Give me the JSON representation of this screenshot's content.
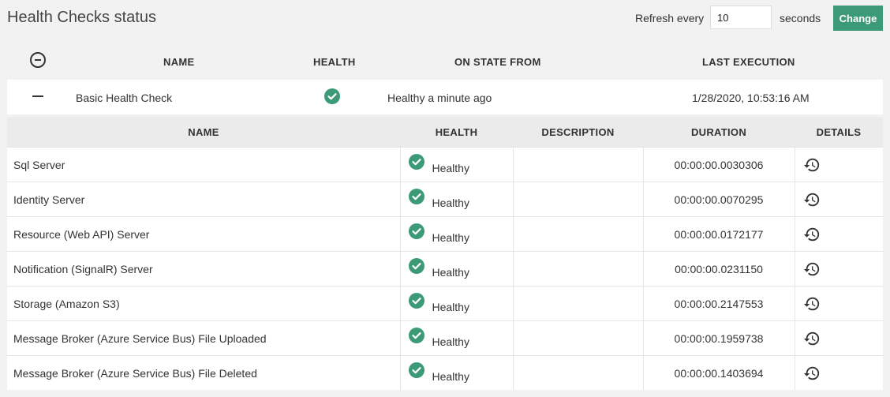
{
  "page": {
    "title": "Health Checks status"
  },
  "refresh": {
    "label": "Refresh every",
    "value": "10",
    "unit": "seconds",
    "button": "Change"
  },
  "main_columns": [
    "NAME",
    "HEALTH",
    "ON STATE FROM",
    "LAST EXECUTION"
  ],
  "check": {
    "name": "Basic Health Check",
    "health_icon": "check-circle-icon",
    "on_state_from": "Healthy a minute ago",
    "last_execution": "1/28/2020, 10:53:16 AM"
  },
  "detail_columns": [
    "NAME",
    "HEALTH",
    "DESCRIPTION",
    "DURATION",
    "DETAILS"
  ],
  "entries": [
    {
      "name": "Sql Server",
      "health": "Healthy",
      "description": "",
      "duration": "00:00:00.0030306",
      "details_icon": "history-icon"
    },
    {
      "name": "Identity Server",
      "health": "Healthy",
      "description": "",
      "duration": "00:00:00.0070295",
      "details_icon": "history-icon"
    },
    {
      "name": "Resource (Web API) Server",
      "health": "Healthy",
      "description": "",
      "duration": "00:00:00.0172177",
      "details_icon": "history-icon"
    },
    {
      "name": "Notification (SignalR) Server",
      "health": "Healthy",
      "description": "",
      "duration": "00:00:00.0231150",
      "details_icon": "history-icon"
    },
    {
      "name": "Storage (Amazon S3)",
      "health": "Healthy",
      "description": "",
      "duration": "00:00:00.2147553",
      "details_icon": "history-icon"
    },
    {
      "name": "Message Broker (Azure Service Bus) File Uploaded",
      "health": "Healthy",
      "description": "",
      "duration": "00:00:00.1959738",
      "details_icon": "history-icon"
    },
    {
      "name": "Message Broker (Azure Service Bus) File Deleted",
      "health": "Healthy",
      "description": "",
      "duration": "00:00:00.1403694",
      "details_icon": "history-icon"
    }
  ],
  "colors": {
    "accent": "#3d9a76",
    "background": "#f2f2f2",
    "header_bg": "#ebebeb"
  }
}
